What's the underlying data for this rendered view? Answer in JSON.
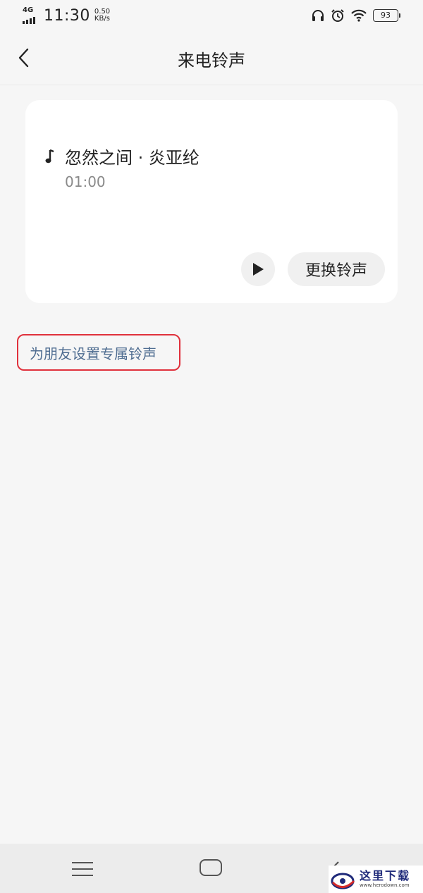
{
  "status_bar": {
    "network": "4G",
    "time": "11:30",
    "speed_value": "0.50",
    "speed_unit": "KB/s",
    "battery": "93",
    "icons": [
      "headphones-icon",
      "alarm-icon",
      "wifi-icon",
      "battery-icon"
    ]
  },
  "header": {
    "title": "来电铃声"
  },
  "ringtone": {
    "song_title": "忽然之间 · 炎亚纶",
    "duration": "01:00",
    "change_label": "更换铃声"
  },
  "friend_ringtone": {
    "label": "为朋友设置专属铃声"
  },
  "watermark": {
    "cn": "这里下载",
    "en": "www.herodown.com"
  },
  "colors": {
    "background": "#f6f6f6",
    "card": "#ffffff",
    "link": "#4f6d91",
    "highlight": "#e0313c",
    "nav_bar": "#ececec"
  }
}
